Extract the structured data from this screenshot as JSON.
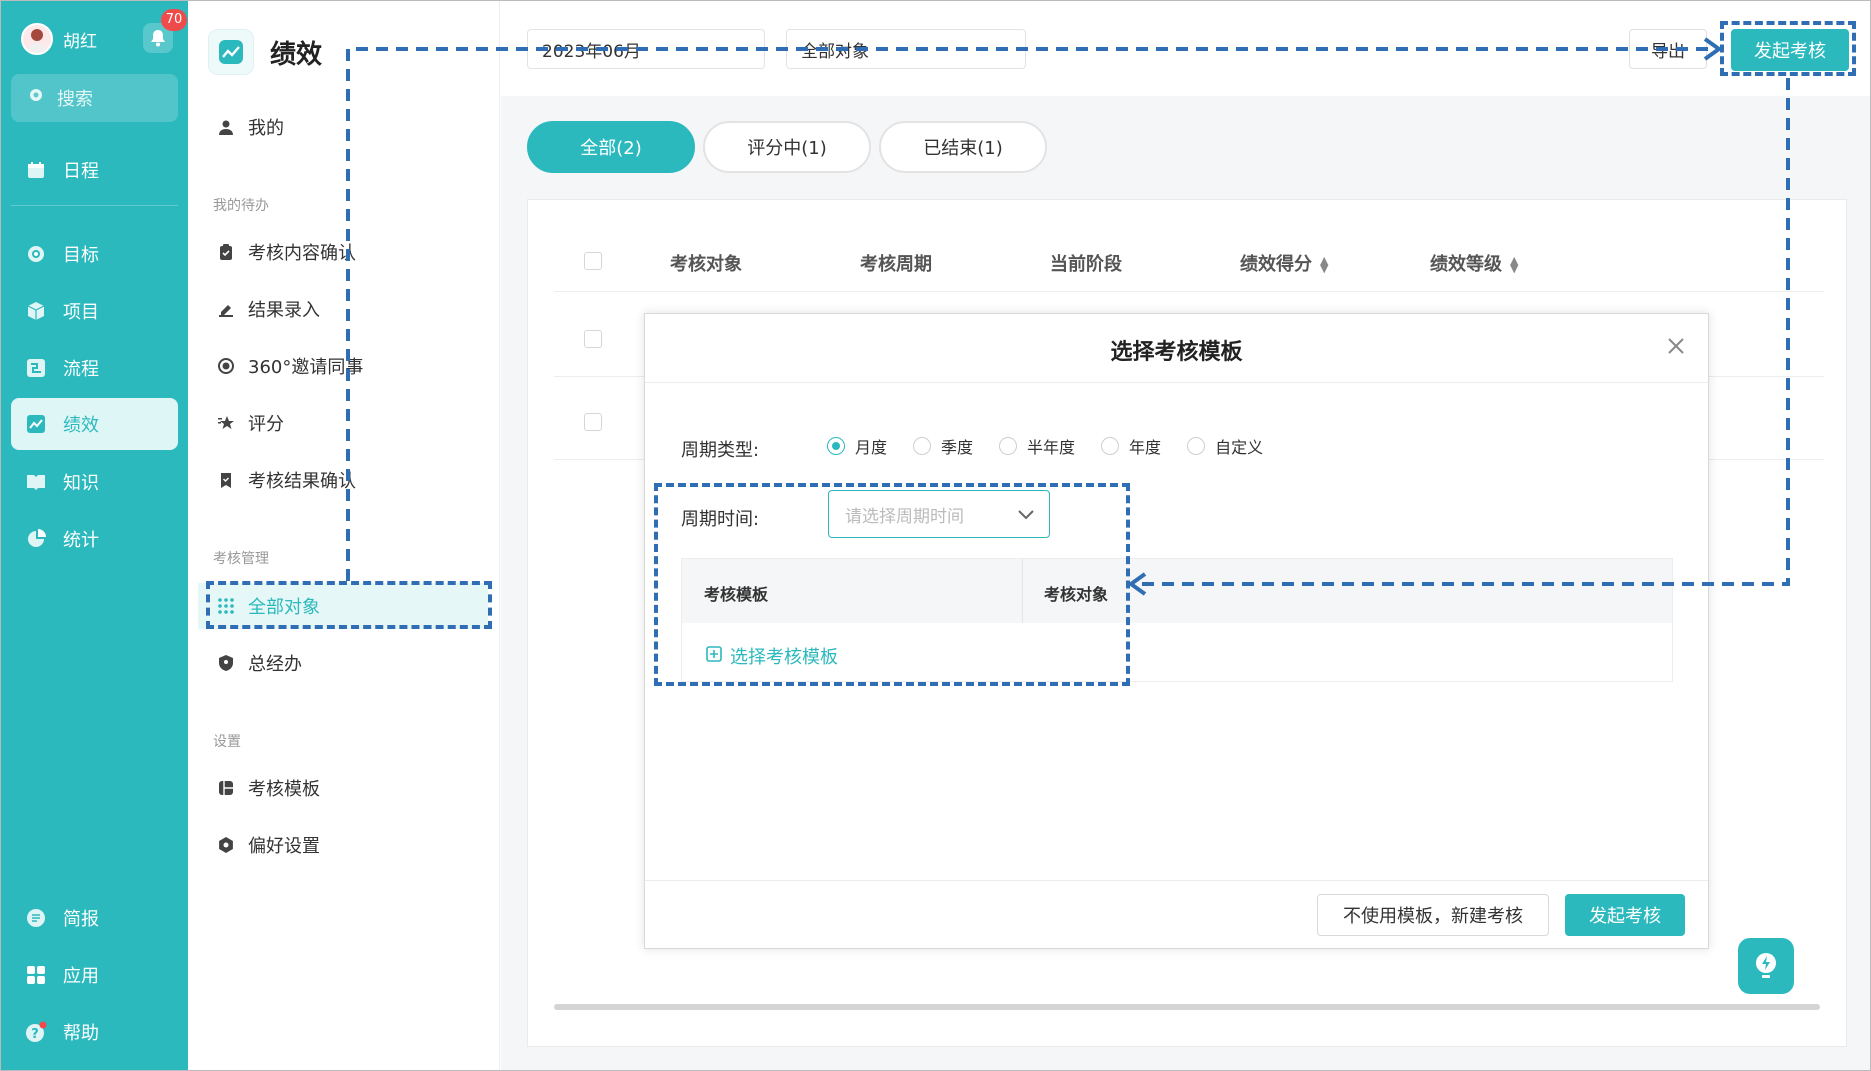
{
  "user": {
    "name": "胡红",
    "notifications": "70"
  },
  "nav": {
    "search": "搜索",
    "items": [
      {
        "label": "日程",
        "icon": "calendar-icon"
      },
      {
        "label": "目标",
        "icon": "target-icon"
      },
      {
        "label": "项目",
        "icon": "cube-icon"
      },
      {
        "label": "流程",
        "icon": "flow-icon"
      },
      {
        "label": "绩效",
        "icon": "chart-icon",
        "active": true
      },
      {
        "label": "知识",
        "icon": "book-icon"
      },
      {
        "label": "统计",
        "icon": "pie-icon"
      },
      {
        "label": "简报",
        "icon": "report-icon"
      },
      {
        "label": "应用",
        "icon": "grid-icon"
      },
      {
        "label": "帮助",
        "icon": "help-icon"
      }
    ]
  },
  "side": {
    "title": "绩效",
    "my": "我的",
    "group_todo": "我的待办",
    "todo_items": [
      "考核内容确认",
      "结果录入",
      "360°邀请同事",
      "评分",
      "考核结果确认"
    ],
    "group_manage": "考核管理",
    "manage_items": [
      "全部对象",
      "总经办"
    ],
    "group_settings": "设置",
    "settings_items": [
      "考核模板",
      "偏好设置"
    ]
  },
  "topbar": {
    "month": "2023年06月",
    "target": "全部对象",
    "export": "导出",
    "launch": "发起考核"
  },
  "tabs": [
    {
      "label": "全部(2)",
      "active": true
    },
    {
      "label": "评分中(1)"
    },
    {
      "label": "已结束(1)"
    }
  ],
  "table": {
    "headers": [
      "考核对象",
      "考核周期",
      "当前阶段",
      "绩效得分",
      "绩效等级"
    ]
  },
  "modal": {
    "title": "选择考核模板",
    "period_type_label": "周期类型:",
    "period_types": [
      "月度",
      "季度",
      "半年度",
      "年度",
      "自定义"
    ],
    "period_time_label": "周期时间:",
    "period_time_placeholder": "请选择周期时间",
    "tpl_col_template": "考核模板",
    "tpl_col_target": "考核对象",
    "select_template": "选择考核模板",
    "no_template_button": "不使用模板，新建考核",
    "launch_button": "发起考核"
  },
  "colors": {
    "accent": "#2bb9be",
    "annotation": "#2f6db5"
  }
}
